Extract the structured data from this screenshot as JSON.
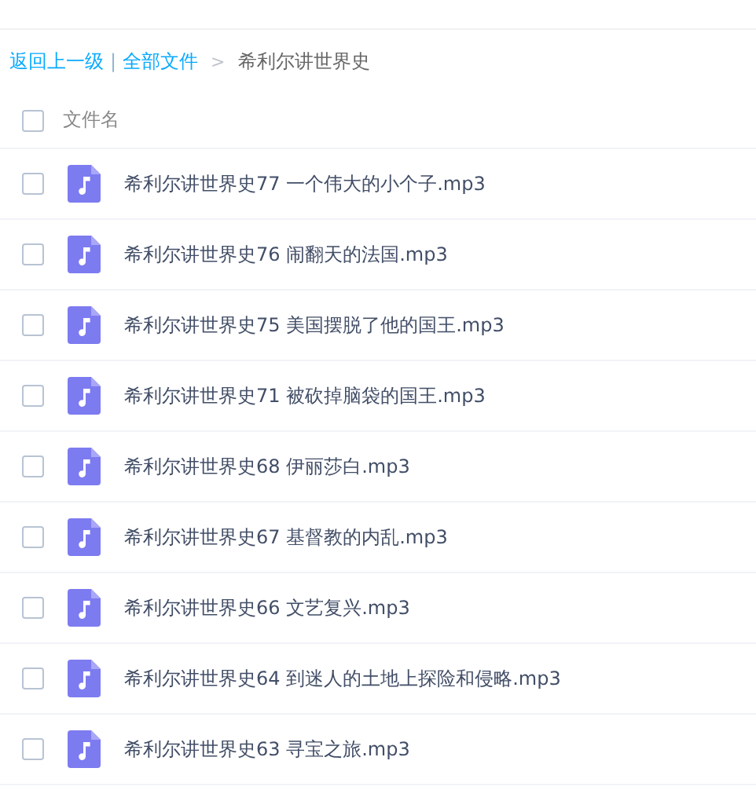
{
  "breadcrumb": {
    "back": "返回上一级",
    "separator": "|",
    "root": "全部文件",
    "arrow": ">",
    "current": "希利尔讲世界史"
  },
  "table": {
    "header": {
      "label": "文件名",
      "checked": false
    },
    "rows": [
      {
        "name": "希利尔讲世界史77 一个伟大的小个子.mp3",
        "checked": false
      },
      {
        "name": "希利尔讲世界史76 闹翻天的法国.mp3",
        "checked": false
      },
      {
        "name": "希利尔讲世界史75 美国摆脱了他的国王.mp3",
        "checked": false
      },
      {
        "name": "希利尔讲世界史71 被砍掉脑袋的国王.mp3",
        "checked": false
      },
      {
        "name": "希利尔讲世界史68 伊丽莎白.mp3",
        "checked": false
      },
      {
        "name": "希利尔讲世界史67 基督教的内乱.mp3",
        "checked": false
      },
      {
        "name": "希利尔讲世界史66 文艺复兴.mp3",
        "checked": false
      },
      {
        "name": "希利尔讲世界史64 到迷人的土地上探险和侵略.mp3",
        "checked": false
      },
      {
        "name": "希利尔讲世界史63 寻宝之旅.mp3",
        "checked": false
      }
    ]
  }
}
